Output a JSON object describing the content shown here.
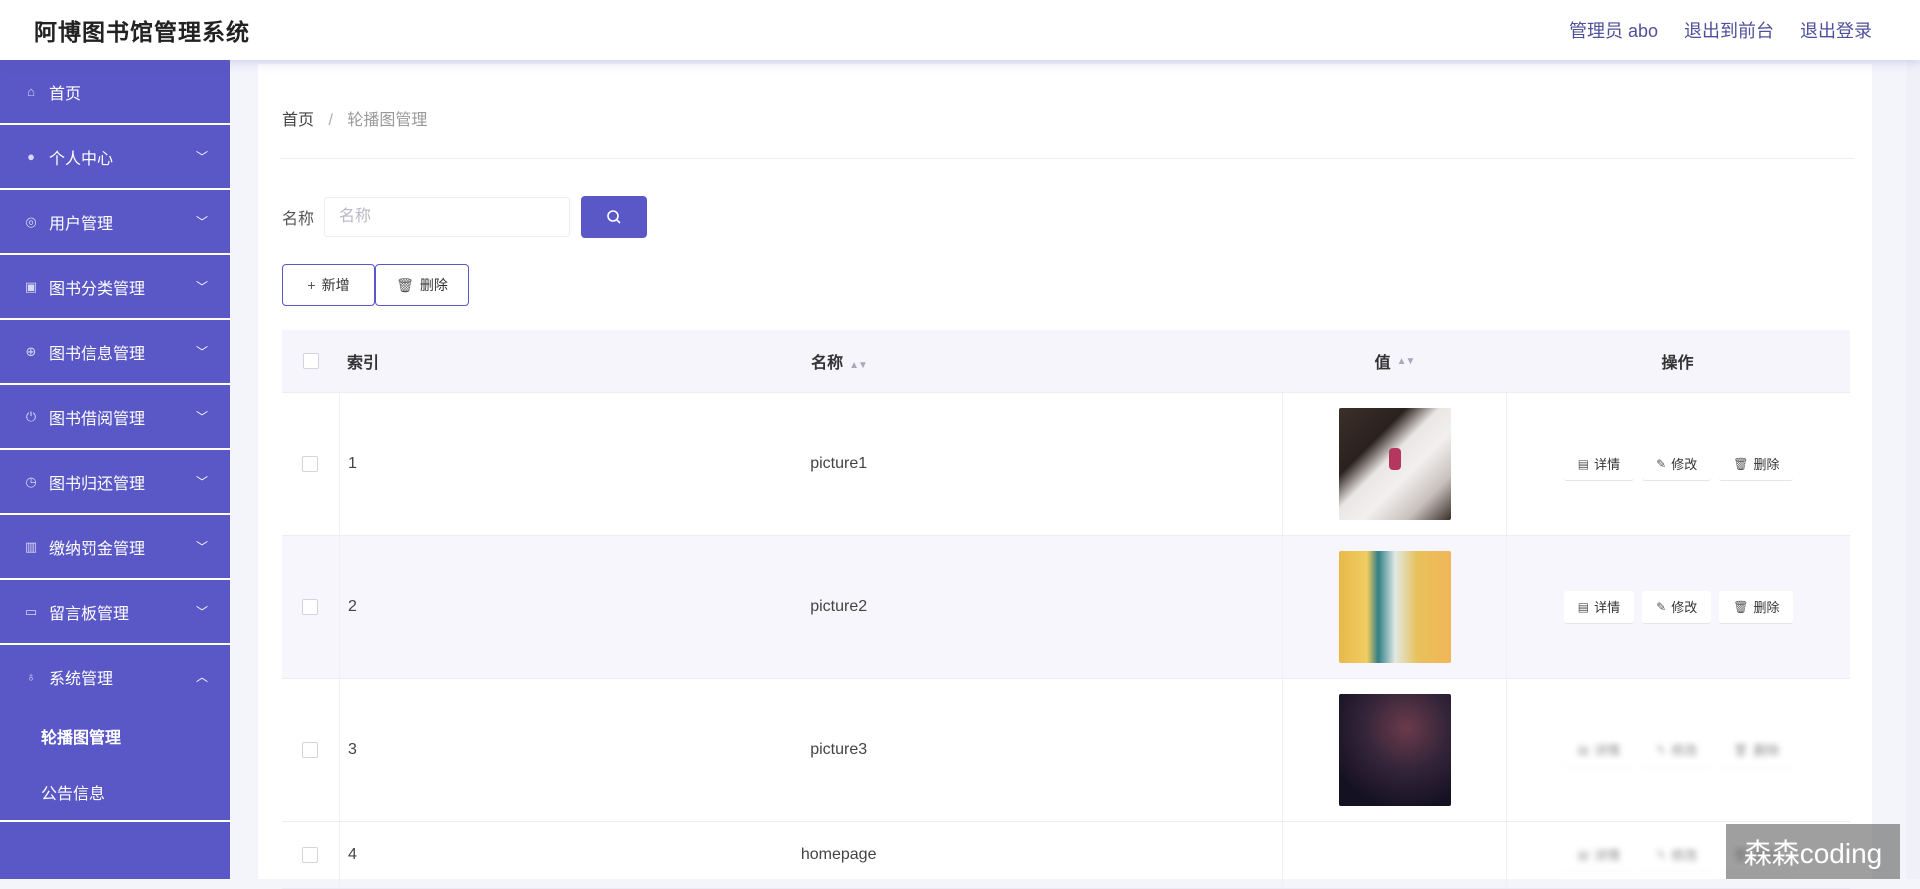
{
  "header": {
    "title": "阿博图书馆管理系统",
    "admin_label": "管理员 abo",
    "to_front": "退出到前台",
    "logout": "退出登录"
  },
  "sidebar": {
    "items": [
      {
        "label": "首页",
        "icon": "home-icon"
      },
      {
        "label": "个人中心",
        "icon": "user-icon"
      },
      {
        "label": "用户管理",
        "icon": "users-icon"
      },
      {
        "label": "图书分类管理",
        "icon": "category-icon"
      },
      {
        "label": "图书信息管理",
        "icon": "book-info-icon"
      },
      {
        "label": "图书借阅管理",
        "icon": "borrow-icon"
      },
      {
        "label": "图书归还管理",
        "icon": "return-icon"
      },
      {
        "label": "缴纳罚金管理",
        "icon": "fine-icon"
      },
      {
        "label": "留言板管理",
        "icon": "message-icon"
      },
      {
        "label": "系统管理",
        "icon": "mic-icon"
      }
    ],
    "sub_items": [
      {
        "label": "轮播图管理"
      },
      {
        "label": "公告信息"
      }
    ]
  },
  "breadcrumb": {
    "home": "首页",
    "separator": "/",
    "current": "轮播图管理"
  },
  "search": {
    "label": "名称",
    "placeholder": "名称"
  },
  "buttons": {
    "add": "新增",
    "delete": "删除"
  },
  "table": {
    "headers": {
      "index": "索引",
      "name": "名称",
      "value": "值",
      "ops": "操作"
    },
    "rows": [
      {
        "index": "1",
        "name": "picture1"
      },
      {
        "index": "2",
        "name": "picture2"
      },
      {
        "index": "3",
        "name": "picture3"
      },
      {
        "index": "4",
        "name": "homepage"
      }
    ],
    "actions": {
      "detail": "详情",
      "edit": "修改",
      "delete": "删除"
    }
  },
  "watermark": "森森coding",
  "colors": {
    "accent": "#5a57c6"
  }
}
